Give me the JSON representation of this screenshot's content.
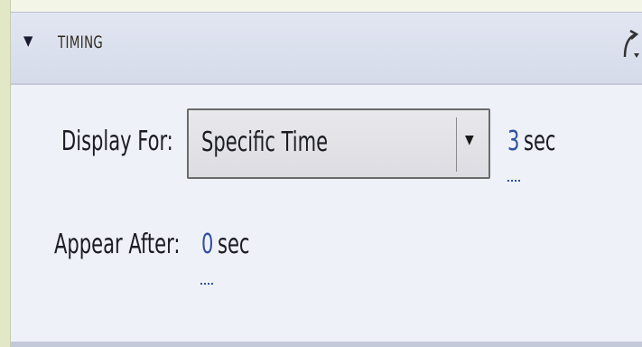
{
  "panel": {
    "title": "TIMING",
    "toggle_icon": "triangle-down-icon",
    "action_icon": "curved-arrow-icon"
  },
  "display_for": {
    "label": "Display For:",
    "selected": "Specific Time",
    "value": "3",
    "unit": "sec"
  },
  "appear_after": {
    "label": "Appear After:",
    "value": "0",
    "unit": "sec"
  },
  "colors": {
    "link": "#2f4fa0",
    "panel_bg": "#eef1f7",
    "header_bg": "#d6dbea",
    "outer_bg": "#e8ecd0"
  }
}
